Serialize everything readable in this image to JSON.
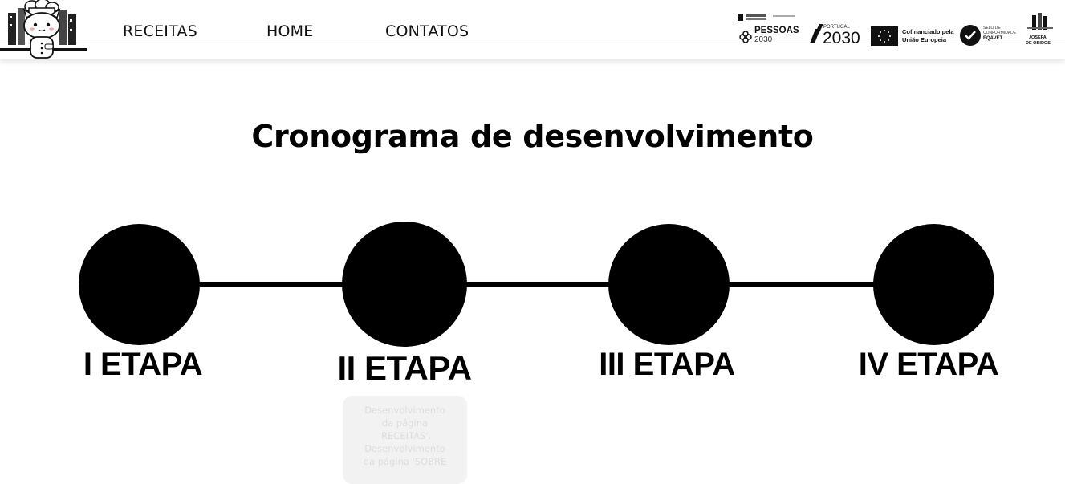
{
  "nav": {
    "items": [
      {
        "label": "RECEITAS"
      },
      {
        "label": "HOME"
      },
      {
        "label": "CONTATOS"
      }
    ]
  },
  "partners": {
    "pessoas": "PESSOAS",
    "pessoas_year": "2030",
    "portugal_small": "PORTUGAL",
    "portugal_year": "2030",
    "eu_line1": "Cofinanciado pela",
    "eu_line2": "União Europeia",
    "eqavet_line1": "SELO DE",
    "eqavet_line2": "CONFORMIDADE",
    "eqavet_line3": "EQAVET",
    "school_line1": "JOSEFA",
    "school_line2": "DE ÓBIDOS"
  },
  "main": {
    "title": "Cronograma de desenvolvimento",
    "steps": [
      {
        "label": "I ETAPA"
      },
      {
        "label": "II ETAPA"
      },
      {
        "label": "III ETAPA"
      },
      {
        "label": "IV ETAPA"
      }
    ],
    "description": [
      "Desenvolvimento",
      "da página",
      "'RECEITAS'.",
      "Desenvolvimento",
      "da página 'SOBRE"
    ]
  },
  "colors": {
    "primary": "#000000",
    "background": "#ffffff",
    "card": "#f2f2f2"
  }
}
